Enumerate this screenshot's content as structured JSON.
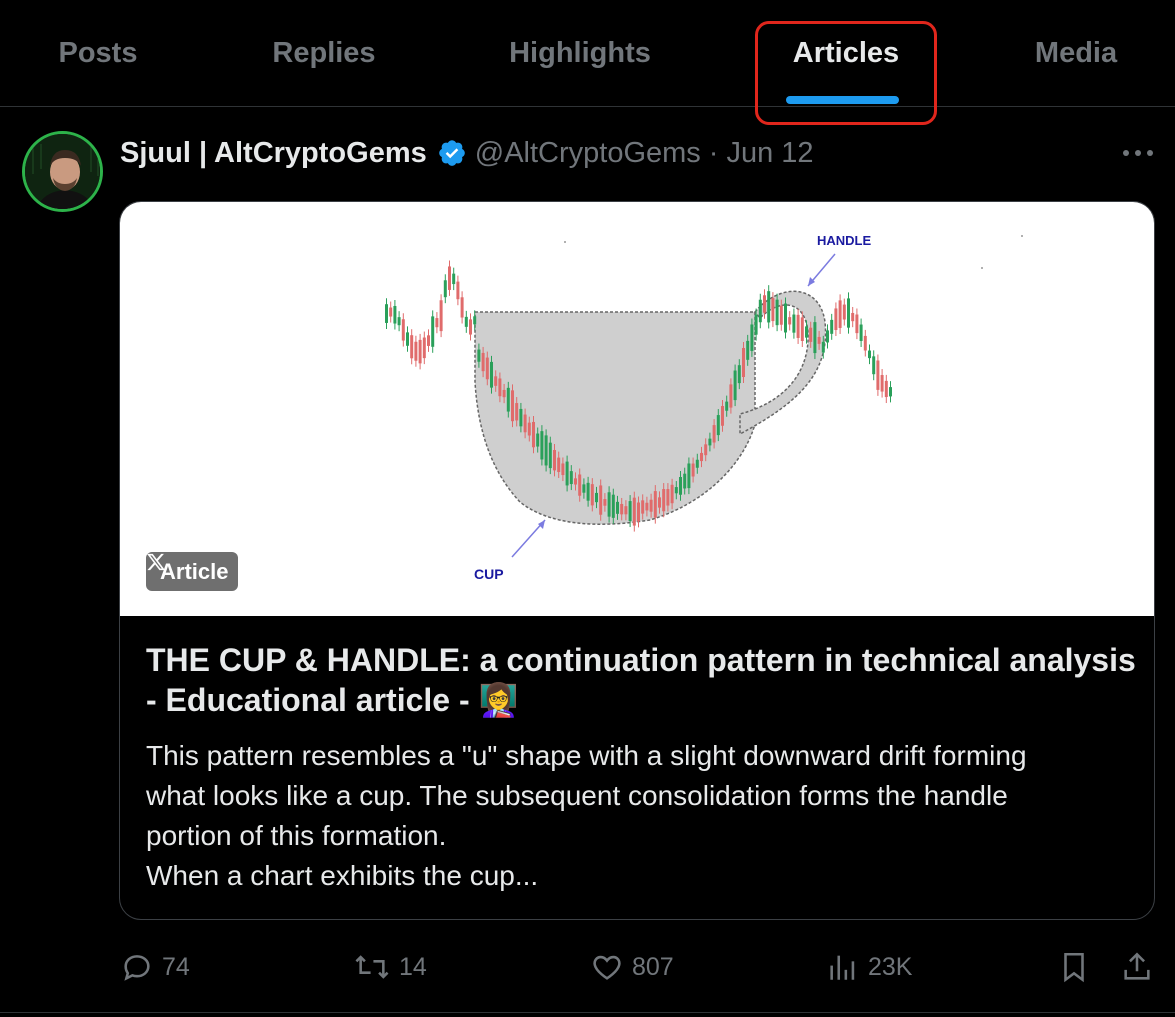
{
  "tabs": [
    {
      "label": "Posts",
      "active": false
    },
    {
      "label": "Replies",
      "active": false
    },
    {
      "label": "Highlights",
      "active": false
    },
    {
      "label": "Articles",
      "active": true
    },
    {
      "label": "Media",
      "active": false
    }
  ],
  "colors": {
    "accent": "#1d9bf0",
    "annotation_box": "#e0261c",
    "background": "#000000",
    "muted_text": "#71767b",
    "primary_text": "#e7e9ea"
  },
  "post": {
    "author_name": "Sjuul | AltCryptoGems",
    "verified": true,
    "handle": "@AltCryptoGems",
    "separator": "·",
    "date": "Jun 12",
    "article": {
      "badge_label": "Article",
      "image_labels": {
        "handle": "HANDLE",
        "cup": "CUP"
      },
      "title": "THE CUP & HANDLE: a continuation pattern in technical analysis - Educational article -",
      "title_emoji": "👩‍🏫",
      "description_lines": [
        "This pattern resembles a \"u\" shape with a slight downward drift forming",
        "what looks like a cup. The subsequent consolidation forms the handle",
        "portion of this formation.",
        "When a chart exhibits the cup..."
      ]
    },
    "stats": {
      "replies": "74",
      "reposts": "14",
      "likes": "807",
      "views": "23K"
    }
  },
  "icons": [
    "verified-badge-icon",
    "more-icon",
    "x-logo-icon",
    "reply-icon",
    "repost-icon",
    "like-icon",
    "views-icon",
    "bookmark-icon",
    "share-icon"
  ]
}
